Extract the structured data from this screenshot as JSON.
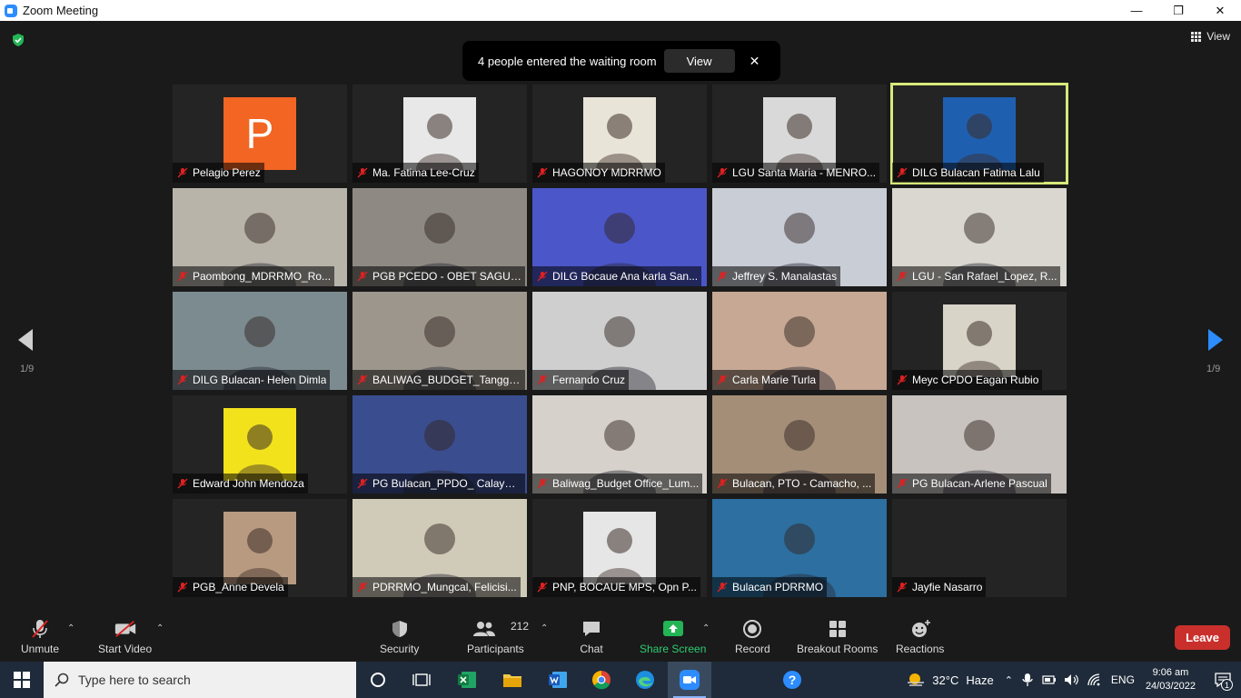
{
  "window": {
    "title": "Zoom Meeting"
  },
  "top": {
    "view_label": "View"
  },
  "notification": {
    "message": "4 people entered the waiting room",
    "view_label": "View"
  },
  "pagination": {
    "left": "1/9",
    "right": "1/9"
  },
  "participants": [
    {
      "name": "Pelagio Perez",
      "kind": "avatar",
      "initial": "P",
      "color": "#F26522"
    },
    {
      "name": "Ma. Fatima Lee-Cruz",
      "kind": "photo",
      "color": "#e8e8e8"
    },
    {
      "name": "HAGONOY MDRRMO",
      "kind": "photo",
      "color": "#e9e4d8"
    },
    {
      "name": "LGU Santa Maria - MENRO...",
      "kind": "photo",
      "color": "#d9d9d9"
    },
    {
      "name": "DILG Bulacan Fatima Lalu",
      "kind": "photo",
      "color": "#1f5fb0",
      "speaker": true
    },
    {
      "name": "Paombong_MDRRMO_Ro...",
      "kind": "video",
      "color": "#b9b4aa"
    },
    {
      "name": "PGB PCEDO - OBET SAGUI...",
      "kind": "video",
      "color": "#8e8a83"
    },
    {
      "name": "DILG Bocaue Ana karla San...",
      "kind": "video",
      "color": "#4b56c9"
    },
    {
      "name": "Jeffrey S. Manalastas",
      "kind": "video",
      "color": "#c9cdd6"
    },
    {
      "name": "LGU - San Rafael_Lopez, R...",
      "kind": "video",
      "color": "#d9d7cf"
    },
    {
      "name": "DILG Bulacan- Helen Dimla",
      "kind": "video",
      "color": "#7c8b90"
    },
    {
      "name": "BALIWAG_BUDGET_Tanggol...",
      "kind": "video",
      "color": "#9c968c"
    },
    {
      "name": "Fernando Cruz",
      "kind": "video",
      "color": "#cfcfcf"
    },
    {
      "name": "Carla Marie Turla",
      "kind": "video",
      "color": "#c7a894"
    },
    {
      "name": "Meyc CPDO Eagan Rubio",
      "kind": "photo",
      "color": "#d8d4c8"
    },
    {
      "name": "Edward John Mendoza",
      "kind": "photo",
      "color": "#f2e21c"
    },
    {
      "name": "PG Bulacan_PPDO_ Calayag...",
      "kind": "video",
      "color": "#3a4d8f"
    },
    {
      "name": "Baliwag_Budget Office_Lum...",
      "kind": "video",
      "color": "#d6d1cb"
    },
    {
      "name": "Bulacan, PTO - Camacho, ...",
      "kind": "video",
      "color": "#a58e78"
    },
    {
      "name": "PG Bulacan-Arlene Pascual",
      "kind": "video",
      "color": "#c8c3bf"
    },
    {
      "name": "PGB_Anne Devela",
      "kind": "photo",
      "color": "#b89a80"
    },
    {
      "name": "PDRRMO_Mungcal, Felicisi...",
      "kind": "video",
      "color": "#cfcbb8"
    },
    {
      "name": "PNP, BOCAUE MPS, Opn P...",
      "kind": "photo",
      "color": "#e6e6e6"
    },
    {
      "name": "Bulacan PDRRMO",
      "kind": "video",
      "color": "#2c6fa0"
    },
    {
      "name": "Jayfie Nasarro",
      "kind": "none",
      "color": "#242424"
    }
  ],
  "toolbar": {
    "unmute": "Unmute",
    "start_video": "Start Video",
    "security": "Security",
    "participants": "Participants",
    "participant_count": "212",
    "chat": "Chat",
    "share_screen": "Share Screen",
    "record": "Record",
    "breakout_rooms": "Breakout Rooms",
    "reactions": "Reactions",
    "leave": "Leave"
  },
  "taskbar": {
    "search_placeholder": "Type here to search",
    "temperature": "32°C",
    "weather": "Haze",
    "language": "ENG",
    "time": "9:06 am",
    "date": "24/03/2022",
    "notification_count": "1"
  },
  "colors": {
    "accent": "#2D8CFF",
    "speaker_outline": "#d8e87a",
    "leave": "#c9302c",
    "share": "#2ecc71",
    "mute": "#e02020"
  }
}
